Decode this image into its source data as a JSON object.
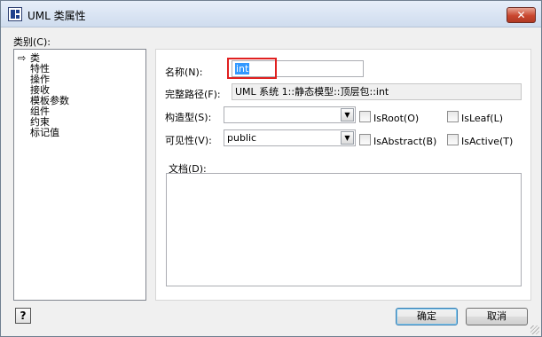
{
  "window": {
    "title": "UML 类属性"
  },
  "title_bar": {
    "close_glyph": "✕"
  },
  "category": {
    "label": "类别(C):",
    "items": [
      "类",
      "特性",
      "操作",
      "接收",
      "模板参数",
      "组件",
      "约束",
      "标记值"
    ],
    "selected_marker": "⇨"
  },
  "form": {
    "name_label": "名称(N):",
    "name_value": "int",
    "fullpath_label": "完整路径(F):",
    "fullpath_value": "UML 系统 1::静态模型::顶层包::int",
    "stereotype_label": "构造型(S):",
    "stereotype_value": "",
    "visibility_label": "可见性(V):",
    "visibility_value": "public",
    "isroot_label": "IsRoot(O)",
    "isleaf_label": "IsLeaf(L)",
    "isabstract_label": "IsAbstract(B)",
    "isactive_label": "IsActive(T)",
    "doc_label": "文档(D):",
    "doc_value": ""
  },
  "footer": {
    "help_glyph": "?",
    "ok_label": "确定",
    "cancel_label": "取消"
  },
  "colors": {
    "highlight": "#e02020",
    "selection": "#3399ff",
    "close": "#c9462e"
  }
}
